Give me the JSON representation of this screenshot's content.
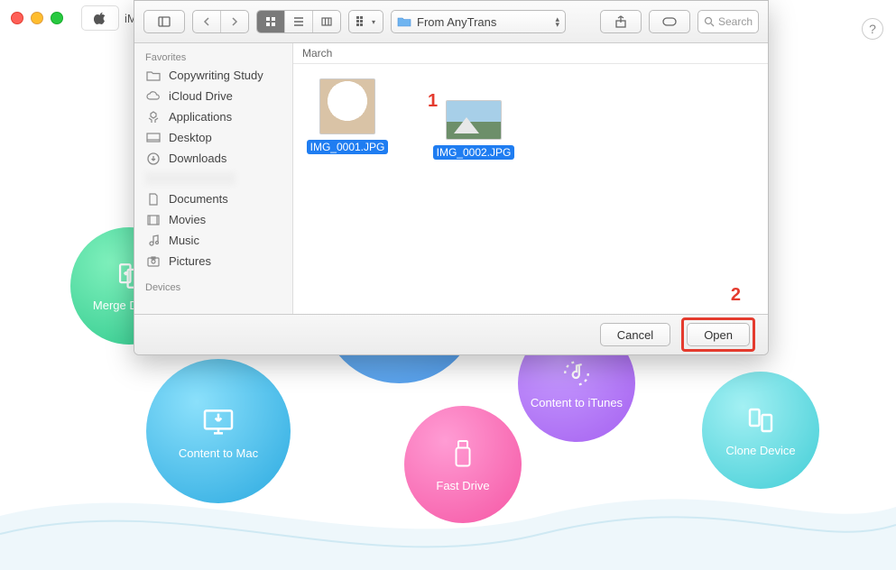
{
  "window": {
    "address_prefix": "iM"
  },
  "help_tooltip": "?",
  "dialog": {
    "folder": "From AnyTrans",
    "search_placeholder": "Search",
    "breadcrumb": "March",
    "sidebar": {
      "section_favorites": "Favorites",
      "section_devices": "Devices",
      "items": [
        {
          "label": "Copywriting Study",
          "icon": "folder"
        },
        {
          "label": "iCloud Drive",
          "icon": "cloud"
        },
        {
          "label": "Applications",
          "icon": "apps"
        },
        {
          "label": "Desktop",
          "icon": "desktop"
        },
        {
          "label": "Downloads",
          "icon": "download"
        },
        {
          "label": "Documents",
          "icon": "doc"
        },
        {
          "label": "Movies",
          "icon": "movie"
        },
        {
          "label": "Music",
          "icon": "music"
        },
        {
          "label": "Pictures",
          "icon": "picture"
        }
      ]
    },
    "files": [
      {
        "name": "IMG_0001.JPG",
        "thumb": "dog"
      },
      {
        "name": "IMG_0002.JPG",
        "thumb": "mountain"
      }
    ],
    "buttons": {
      "cancel": "Cancel",
      "open": "Open"
    }
  },
  "annotations": {
    "one": "1",
    "two": "2"
  },
  "circles": {
    "merge": {
      "label": "Merge Device",
      "color1": "#58e3a2",
      "color2": "#2ec98c"
    },
    "tomac": {
      "label": "Content to Mac",
      "color1": "#5fd2f5",
      "color2": "#2aa9e0"
    },
    "fast": {
      "label": "Fast Drive",
      "color1": "#ff7bc2",
      "color2": "#f556a4"
    },
    "itunes": {
      "label": "Content to iTunes",
      "color1": "#a87bff",
      "color2": "#b260f0"
    },
    "clone": {
      "label": "Clone Device",
      "color1": "#7be6ea",
      "color2": "#41cdd6"
    }
  }
}
